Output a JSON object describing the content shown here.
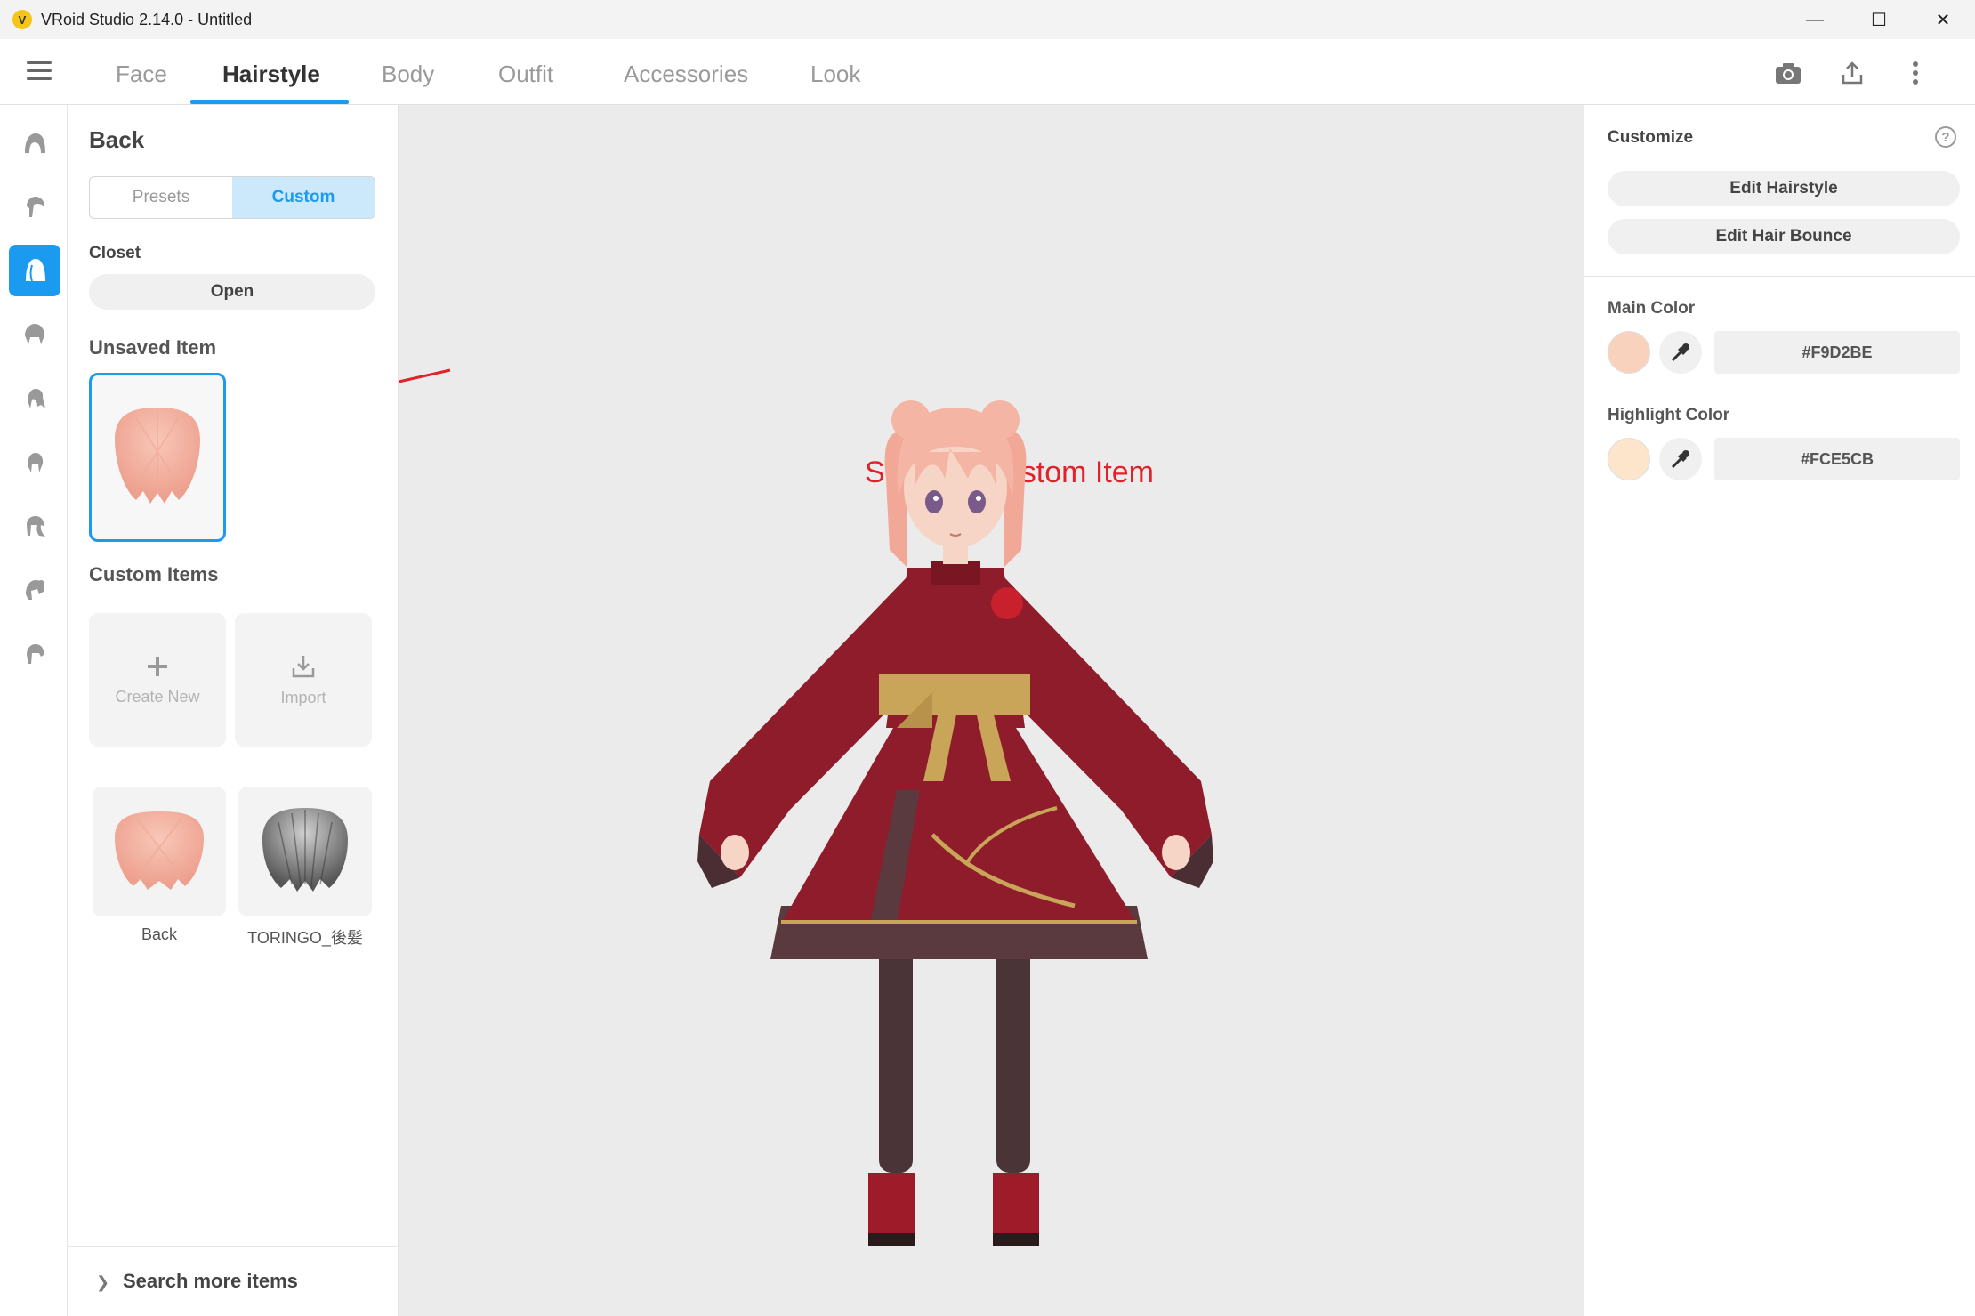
{
  "window": {
    "title": "VRoid Studio 2.14.0 - Untitled",
    "logo_glyph": "V",
    "minimize_glyph": "—",
    "maximize_glyph": "☐",
    "close_glyph": "✕"
  },
  "tabs": [
    {
      "label": "Face"
    },
    {
      "label": "Hairstyle",
      "active": true
    },
    {
      "label": "Body"
    },
    {
      "label": "Outfit"
    },
    {
      "label": "Accessories"
    },
    {
      "label": "Look"
    }
  ],
  "top_icons": [
    "camera-icon",
    "export-icon",
    "more-icon"
  ],
  "rail_icons": [
    "hair-base-icon",
    "front-hair-icon",
    "back-hair-icon",
    "side-hair-icon",
    "ponytail-icon",
    "hair-extension-icon",
    "ahoge-icon",
    "hair-accessory-icon",
    "hair-misc-icon"
  ],
  "left_panel": {
    "title": "Back",
    "segment": {
      "presets": "Presets",
      "custom": "Custom",
      "active": "custom"
    },
    "closet_label": "Closet",
    "open_label": "Open",
    "unsaved_label": "Unsaved Item",
    "custom_items_label": "Custom Items",
    "create_new_label": "Create New",
    "import_label": "Import",
    "items": [
      {
        "label": "Back"
      },
      {
        "label": "TORINGO_後髪"
      }
    ],
    "search_more_label": "Search more items"
  },
  "annotation": {
    "text": "Save as Custom Item",
    "color": "#e2222a"
  },
  "right_panel": {
    "customize_label": "Customize",
    "help_glyph": "?",
    "edit_hairstyle_label": "Edit Hairstyle",
    "edit_bounce_label": "Edit Hair Bounce",
    "main_color_label": "Main Color",
    "main_color_hex": "#F9D2BE",
    "highlight_color_label": "Highlight Color",
    "highlight_color_hex": "#FCE5CB"
  },
  "colors": {
    "accent": "#1a9bf0",
    "hair": "#f4b5a4",
    "dress": "#8e1c2a"
  }
}
